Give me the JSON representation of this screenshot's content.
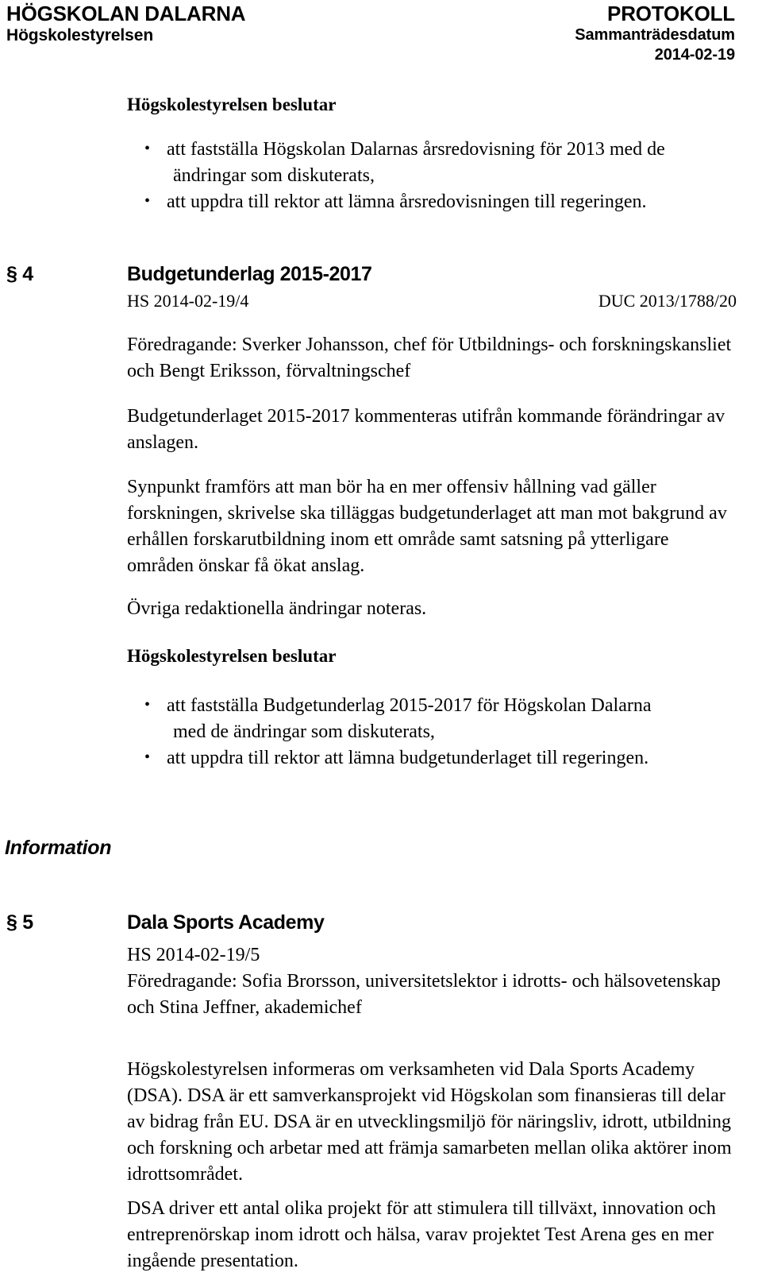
{
  "header": {
    "organisation": "HÖGSKOLAN DALARNA",
    "unit": "Högskolestyrelsen",
    "doc_type": "PROTOKOLL",
    "date_label": "Sammanträdesdatum",
    "date": "2014-02-19"
  },
  "decision_block_top": {
    "heading": "Högskolestyrelsen beslutar",
    "items": [
      {
        "line1": "att fastställa Högskolan Dalarnas årsredovisning för 2013 med de",
        "line2": "ändringar som diskuterats,"
      },
      {
        "line1": "att uppdra till rektor att lämna årsredovisningen till regeringen.",
        "line2": ""
      }
    ]
  },
  "section_4": {
    "marker": "§ 4",
    "title": "Budgetunderlag 2015-2017",
    "ref_left": "HS 2014-02-19/4",
    "ref_right": "DUC 2013/1788/20",
    "presenter": "Föredragande: Sverker Johansson, chef för Utbildnings- och forskningskansliet och Bengt Eriksson, förvaltningschef",
    "paragraph_1": "Budgetunderlaget 2015-2017 kommenteras utifrån kommande förändringar av anslagen.",
    "paragraph_2": "Synpunkt framförs att man bör ha en mer offensiv hållning vad gäller forskningen, skrivelse ska tilläggas budgetunderlaget att man mot bakgrund av erhållen forskarutbildning inom ett område samt satsning på ytterligare områden önskar få ökat anslag.",
    "paragraph_3": "Övriga redaktionella ändringar noteras.",
    "decision_heading": "Högskolestyrelsen beslutar",
    "decisions": [
      {
        "line1": "att fastställa Budgetunderlag 2015-2017 för Högskolan Dalarna",
        "line2": "med de ändringar som diskuterats,"
      },
      {
        "line1": "att uppdra till rektor att lämna budgetunderlaget till regeringen.",
        "line2": ""
      }
    ]
  },
  "information_heading": "Information",
  "section_5": {
    "marker": "§ 5",
    "title": "Dala Sports Academy",
    "ref_left": "HS 2014-02-19/5",
    "presenter": "Föredragande: Sofia Brorsson, universitetslektor i idrotts- och hälsovetenskap och Stina Jeffner, akademichef",
    "paragraph_1": "Högskolestyrelsen informeras om verksamheten vid Dala Sports Academy (DSA). DSA är ett samverkansprojekt vid Högskolan som finansieras till delar av bidrag från EU. DSA är en utvecklingsmiljö för näringsliv, idrott, utbildning och forskning och arbetar med att främja samarbeten mellan olika aktörer inom idrottsområdet.",
    "paragraph_2": "DSA driver ett antal olika projekt för att stimulera till tillväxt, innovation och entreprenörskap inom idrott och hälsa, varav projektet Test Arena ges en mer ingående presentation."
  }
}
